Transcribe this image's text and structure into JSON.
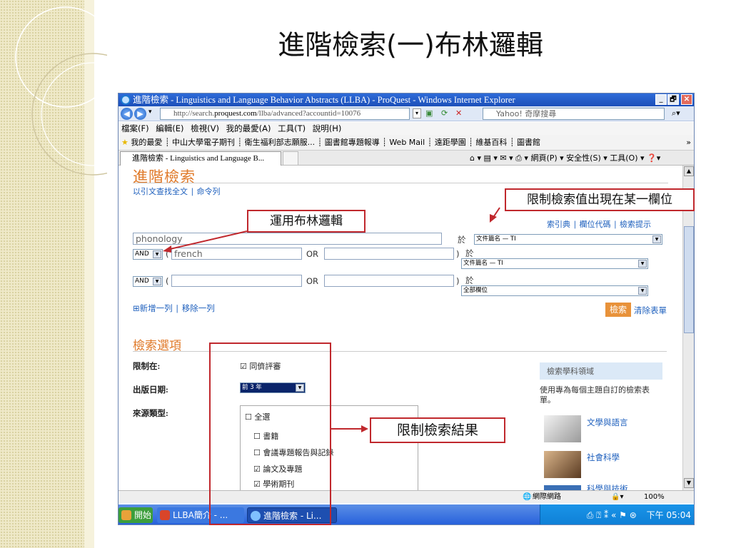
{
  "slide": {
    "title": "進階檢索(一)布林邏輯"
  },
  "window": {
    "title": "進階檢索 - Linguistics and Language Behavior Abstracts (LLBA) - ProQuest - Windows Internet Explorer",
    "controls": [
      "_",
      "🗗",
      "✕"
    ],
    "address_pre": "http://search.",
    "address_bold": "proquest.com",
    "address_post": "/llba/advanced?accountid=10076",
    "search_placeholder": "Yahoo! 奇摩搜尋",
    "menu": "檔案(F) 編輯(E) 檢視(V) 我的最愛(A) 工具(T) 說明(H)",
    "favorites": "我的最愛 ┊ 中山大學電子期刊 ┊ 衛生福利部志願服... ┊ 圖書館專題報導 ┊ Web Mail ┊ 遠距學園 ┊ 維基百科 ┊ 圖書館",
    "tab_title": "進階檢索 - Linguistics and Language B...",
    "tab_tools": "⌂ ▾  ▤ ▾  ✉ ▾  ⎙ ▾  網頁(P) ▾  安全性(S) ▾  工具(O) ▾  ❓▾"
  },
  "page": {
    "title": "進階檢索",
    "top_links": "以引文查找全文 ∣ 命令列",
    "right_links": "索引典 ∣ 欄位代碼 ∣ 檢索提示",
    "row1": {
      "value": "phonology",
      "in_label": "於",
      "field": "文件篇名 — TI"
    },
    "row2": {
      "op": "AND",
      "paren_open": "(",
      "value1": "french",
      "or": "OR",
      "value2": "",
      "paren_close": ")",
      "in_label": "於",
      "field": "文件篇名 — TI"
    },
    "row3": {
      "op": "AND",
      "paren_open": "(",
      "value1": "",
      "or": "OR",
      "value2": "",
      "paren_close": ")",
      "in_label": "於",
      "field": "全部欄位"
    },
    "row_links": "⊞新增一列 ∣ 移除一列",
    "search_button": "檢索",
    "clear_link": "清除表單",
    "options_title": "檢索選項",
    "limit_label": "限制在:",
    "peer_review": "同儕評審",
    "date_label": "出版日期:",
    "date_value": "前 3 年",
    "source_label": "來源類型:",
    "source_types": [
      {
        "label": "全選",
        "checked": false
      },
      {
        "label": "書籍",
        "checked": false
      },
      {
        "label": "會議專題報告與記錄",
        "checked": false
      },
      {
        "label": "論文及專題",
        "checked": true
      },
      {
        "label": "學術期刊",
        "checked": true
      }
    ],
    "subject_box": {
      "heading": "檢索學科領域",
      "desc": "使用專為每個主題自訂的檢索表單。",
      "items": [
        "文學與語言",
        "社會科學",
        "科學與技術"
      ]
    }
  },
  "status": {
    "zone": "網際網路",
    "zoom": "100%"
  },
  "taskbar": {
    "start": "開始",
    "items": [
      "LLBA簡介 - ...",
      "進階檢索 - Li..."
    ],
    "time": "下午 05:04"
  },
  "annotations": {
    "limit_field": "限制檢索值出現在某一欄位",
    "boolean": "運用布林邏輯",
    "limit_results": "限制檢索結果"
  },
  "colors": {
    "accent_orange": "#e07a2a",
    "link_blue": "#1d5fbd",
    "annotation_red": "#c0282d"
  }
}
